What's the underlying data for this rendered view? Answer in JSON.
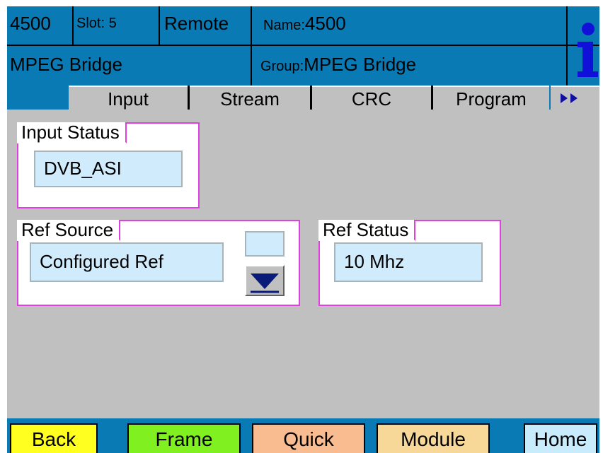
{
  "header": {
    "device": "4500",
    "slot": "Slot: 5",
    "mode": "Remote",
    "name_label": "Name:",
    "name_value": "4500",
    "module": "MPEG Bridge",
    "group_label": "Group:",
    "group_value": "MPEG Bridge",
    "info_icon": "info-icon"
  },
  "tabs": {
    "items": [
      {
        "label": "Input"
      },
      {
        "label": "Stream"
      },
      {
        "label": "CRC"
      },
      {
        "label": "Program"
      }
    ],
    "more_icon": "double-arrow-right-icon"
  },
  "input_status": {
    "title": "Input Status",
    "value": "DVB_ASI"
  },
  "ref_source": {
    "title": "Ref Source",
    "value": "Configured Ref",
    "dropdown_icon": "triangle-down-icon"
  },
  "ref_status": {
    "title": "Ref Status",
    "value": "10 Mhz"
  },
  "buttons": {
    "back": {
      "label": "Back",
      "color": "#ffff20"
    },
    "frame": {
      "label": "Frame",
      "color": "#80f020"
    },
    "quick": {
      "label": "Quick",
      "color": "#f8bc90"
    },
    "module": {
      "label": "Module",
      "color": "#f8d898"
    },
    "home": {
      "label": "Home",
      "color": "#c8ecfc"
    }
  },
  "colors": {
    "header_bg": "#0a7ab4",
    "panel_border": "#e040e0",
    "field_bg": "#d0ecfc",
    "screen_bg": "#c0c0c0"
  }
}
